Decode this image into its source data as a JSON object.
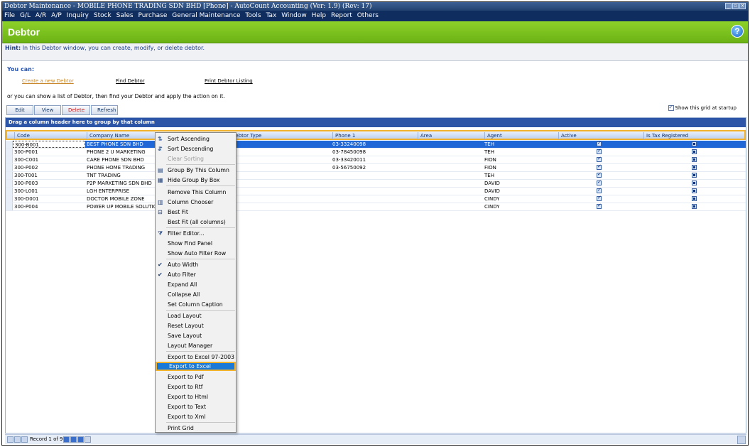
{
  "window": {
    "title": "Debtor Maintenance - MOBILE PHONE TRADING SDN BHD [Phone] - AutoCount Accounting (Ver: 1.9) (Rev: 17)",
    "menu": [
      "File",
      "G/L",
      "A/R",
      "A/P",
      "Inquiry",
      "Stock",
      "Sales",
      "Purchase",
      "General Maintenance",
      "Tools",
      "Tax",
      "Window",
      "Help",
      "Report",
      "Others"
    ]
  },
  "header": {
    "title": "Debtor",
    "help_glyph": "?"
  },
  "hint": {
    "label": "Hint:",
    "text": " In this Debtor window, you can create, modify, or delete debtor."
  },
  "actions": {
    "you_can": "You can:",
    "create": "Create a new Debtor",
    "find": "Find Debtor",
    "print": "Print Debtor Listing",
    "or_text": "or you can show a list of Debtor, then find your Debtor and apply the action on it."
  },
  "buttons": {
    "edit": "Edit",
    "view": "View",
    "delete": "Delete",
    "refresh": "Refresh"
  },
  "show_grid": {
    "label": "Show this grid at startup",
    "checked": true
  },
  "grid": {
    "group_box": "Drag a column header here to group by that column",
    "columns": {
      "code": "Code",
      "company": "Company Name",
      "type": "Debtor Type",
      "phone": "Phone 1",
      "area": "Area",
      "agent": "Agent",
      "active": "Active",
      "tax": "Is Tax Registered"
    },
    "rows": [
      {
        "code": "300-B001",
        "company": "BEST PHONE SDN BHD",
        "phone": "03-33240098",
        "agent": "TEH",
        "active": true,
        "tax": true
      },
      {
        "code": "300-P001",
        "company": "PHONE 2 U MARKETING",
        "phone": "03-78450098",
        "agent": "TEH",
        "active": true,
        "tax": true
      },
      {
        "code": "300-C001",
        "company": "CARE PHONE SDN BHD",
        "phone": "03-33420011",
        "agent": "FION",
        "active": true,
        "tax": true
      },
      {
        "code": "300-P002",
        "company": "PHONE HOME TRADING",
        "phone": "03-56750092",
        "agent": "FION",
        "active": true,
        "tax": true
      },
      {
        "code": "300-T001",
        "company": "TNT TRADING",
        "phone": "",
        "agent": "TEH",
        "active": true,
        "tax": true
      },
      {
        "code": "300-P003",
        "company": "P2P MARKETING SDN BHD",
        "phone": "",
        "agent": "DAVID",
        "active": true,
        "tax": true
      },
      {
        "code": "300-L001",
        "company": "LGH ENTERPRISE",
        "phone": "",
        "agent": "DAVID",
        "active": true,
        "tax": true
      },
      {
        "code": "300-D001",
        "company": "DOCTOR MOBILE ZONE",
        "phone": "",
        "agent": "CINDY",
        "active": true,
        "tax": true
      },
      {
        "code": "300-P004",
        "company": "POWER UP MOBILE SOLUTION",
        "phone": "",
        "agent": "CINDY",
        "active": true,
        "tax": true
      }
    ],
    "record_text": "Record 1 of 9"
  },
  "context_menu": {
    "sort_asc": "Sort Ascending",
    "sort_desc": "Sort Descending",
    "clear_sort": "Clear Sorting",
    "group_by_col": "Group By This Column",
    "hide_group_box": "Hide Group By Box",
    "remove_col": "Remove This Column",
    "col_chooser": "Column Chooser",
    "best_fit": "Best Fit",
    "best_fit_all": "Best Fit (all columns)",
    "filter_editor": "Filter Editor...",
    "show_find": "Show Find Panel",
    "show_auto_filter": "Show Auto Filter Row",
    "auto_width": "Auto Width",
    "auto_filter": "Auto Filter",
    "expand_all": "Expand All",
    "collapse_all": "Collapse All",
    "set_caption": "Set Column Caption",
    "load_layout": "Load Layout",
    "reset_layout": "Reset Layout",
    "save_layout": "Save Layout",
    "layout_manager": "Layout Manager",
    "export_xls97": "Export to Excel 97-2003",
    "export_xls": "Export to Excel",
    "export_pdf": "Export to Pdf",
    "export_rtf": "Export to Rtf",
    "export_html": "Export to Html",
    "export_text": "Export to Text",
    "export_xml": "Export to Xml",
    "print_grid": "Print Grid"
  }
}
